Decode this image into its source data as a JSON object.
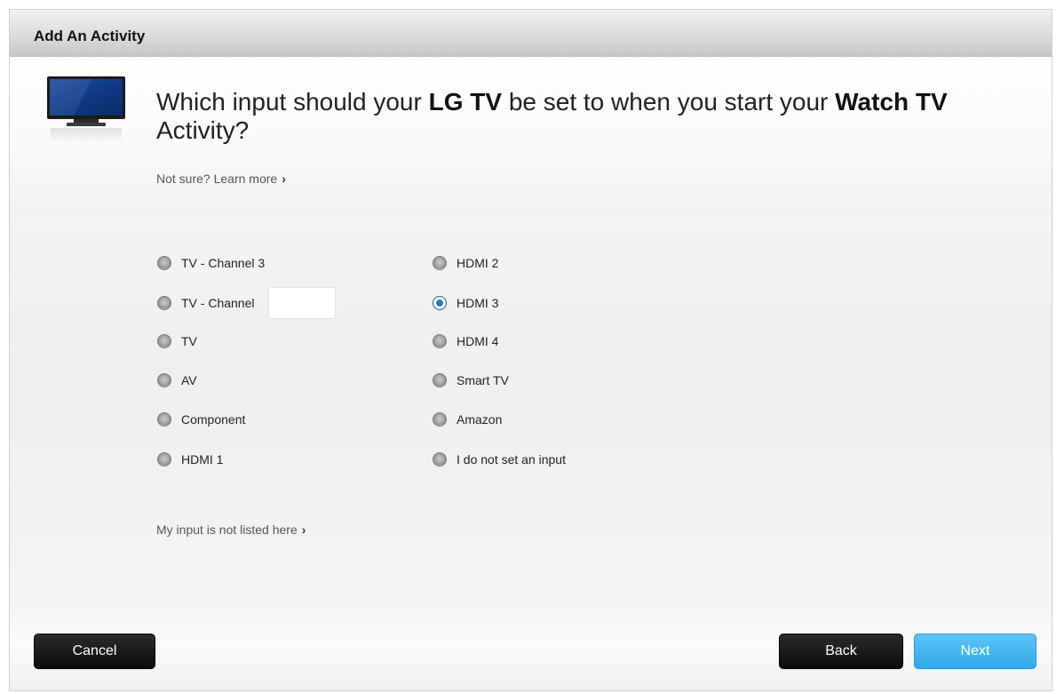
{
  "window": {
    "title": "Add An Activity"
  },
  "question": {
    "prefix": "Which input should your ",
    "device": "LG TV",
    "middle": " be set to when you start your ",
    "activity": "Watch TV",
    "suffix": " Activity?"
  },
  "learn_more": {
    "label": "Not sure? Learn more"
  },
  "options": {
    "left": [
      {
        "label": "TV - Channel 3",
        "selected": false
      },
      {
        "label": "TV - Channel",
        "selected": false,
        "channel_value": ""
      },
      {
        "label": "TV",
        "selected": false
      },
      {
        "label": "AV",
        "selected": false
      },
      {
        "label": "Component",
        "selected": false
      },
      {
        "label": "HDMI 1",
        "selected": false
      }
    ],
    "right": [
      {
        "label": "HDMI 2",
        "selected": false
      },
      {
        "label": "HDMI 3",
        "selected": true
      },
      {
        "label": "HDMI 4",
        "selected": false
      },
      {
        "label": "Smart TV",
        "selected": false
      },
      {
        "label": "Amazon",
        "selected": false
      },
      {
        "label": "I do not set an input",
        "selected": false
      }
    ]
  },
  "not_listed": {
    "label": "My input is not listed here"
  },
  "buttons": {
    "cancel": "Cancel",
    "back": "Back",
    "next": "Next"
  },
  "icons": {
    "device": "tv-icon",
    "chevron": "chevron-right-icon"
  },
  "colors": {
    "accent": "#2fa8ea",
    "dark_button": "#111111",
    "selected_radio": "#1a6fbf"
  }
}
